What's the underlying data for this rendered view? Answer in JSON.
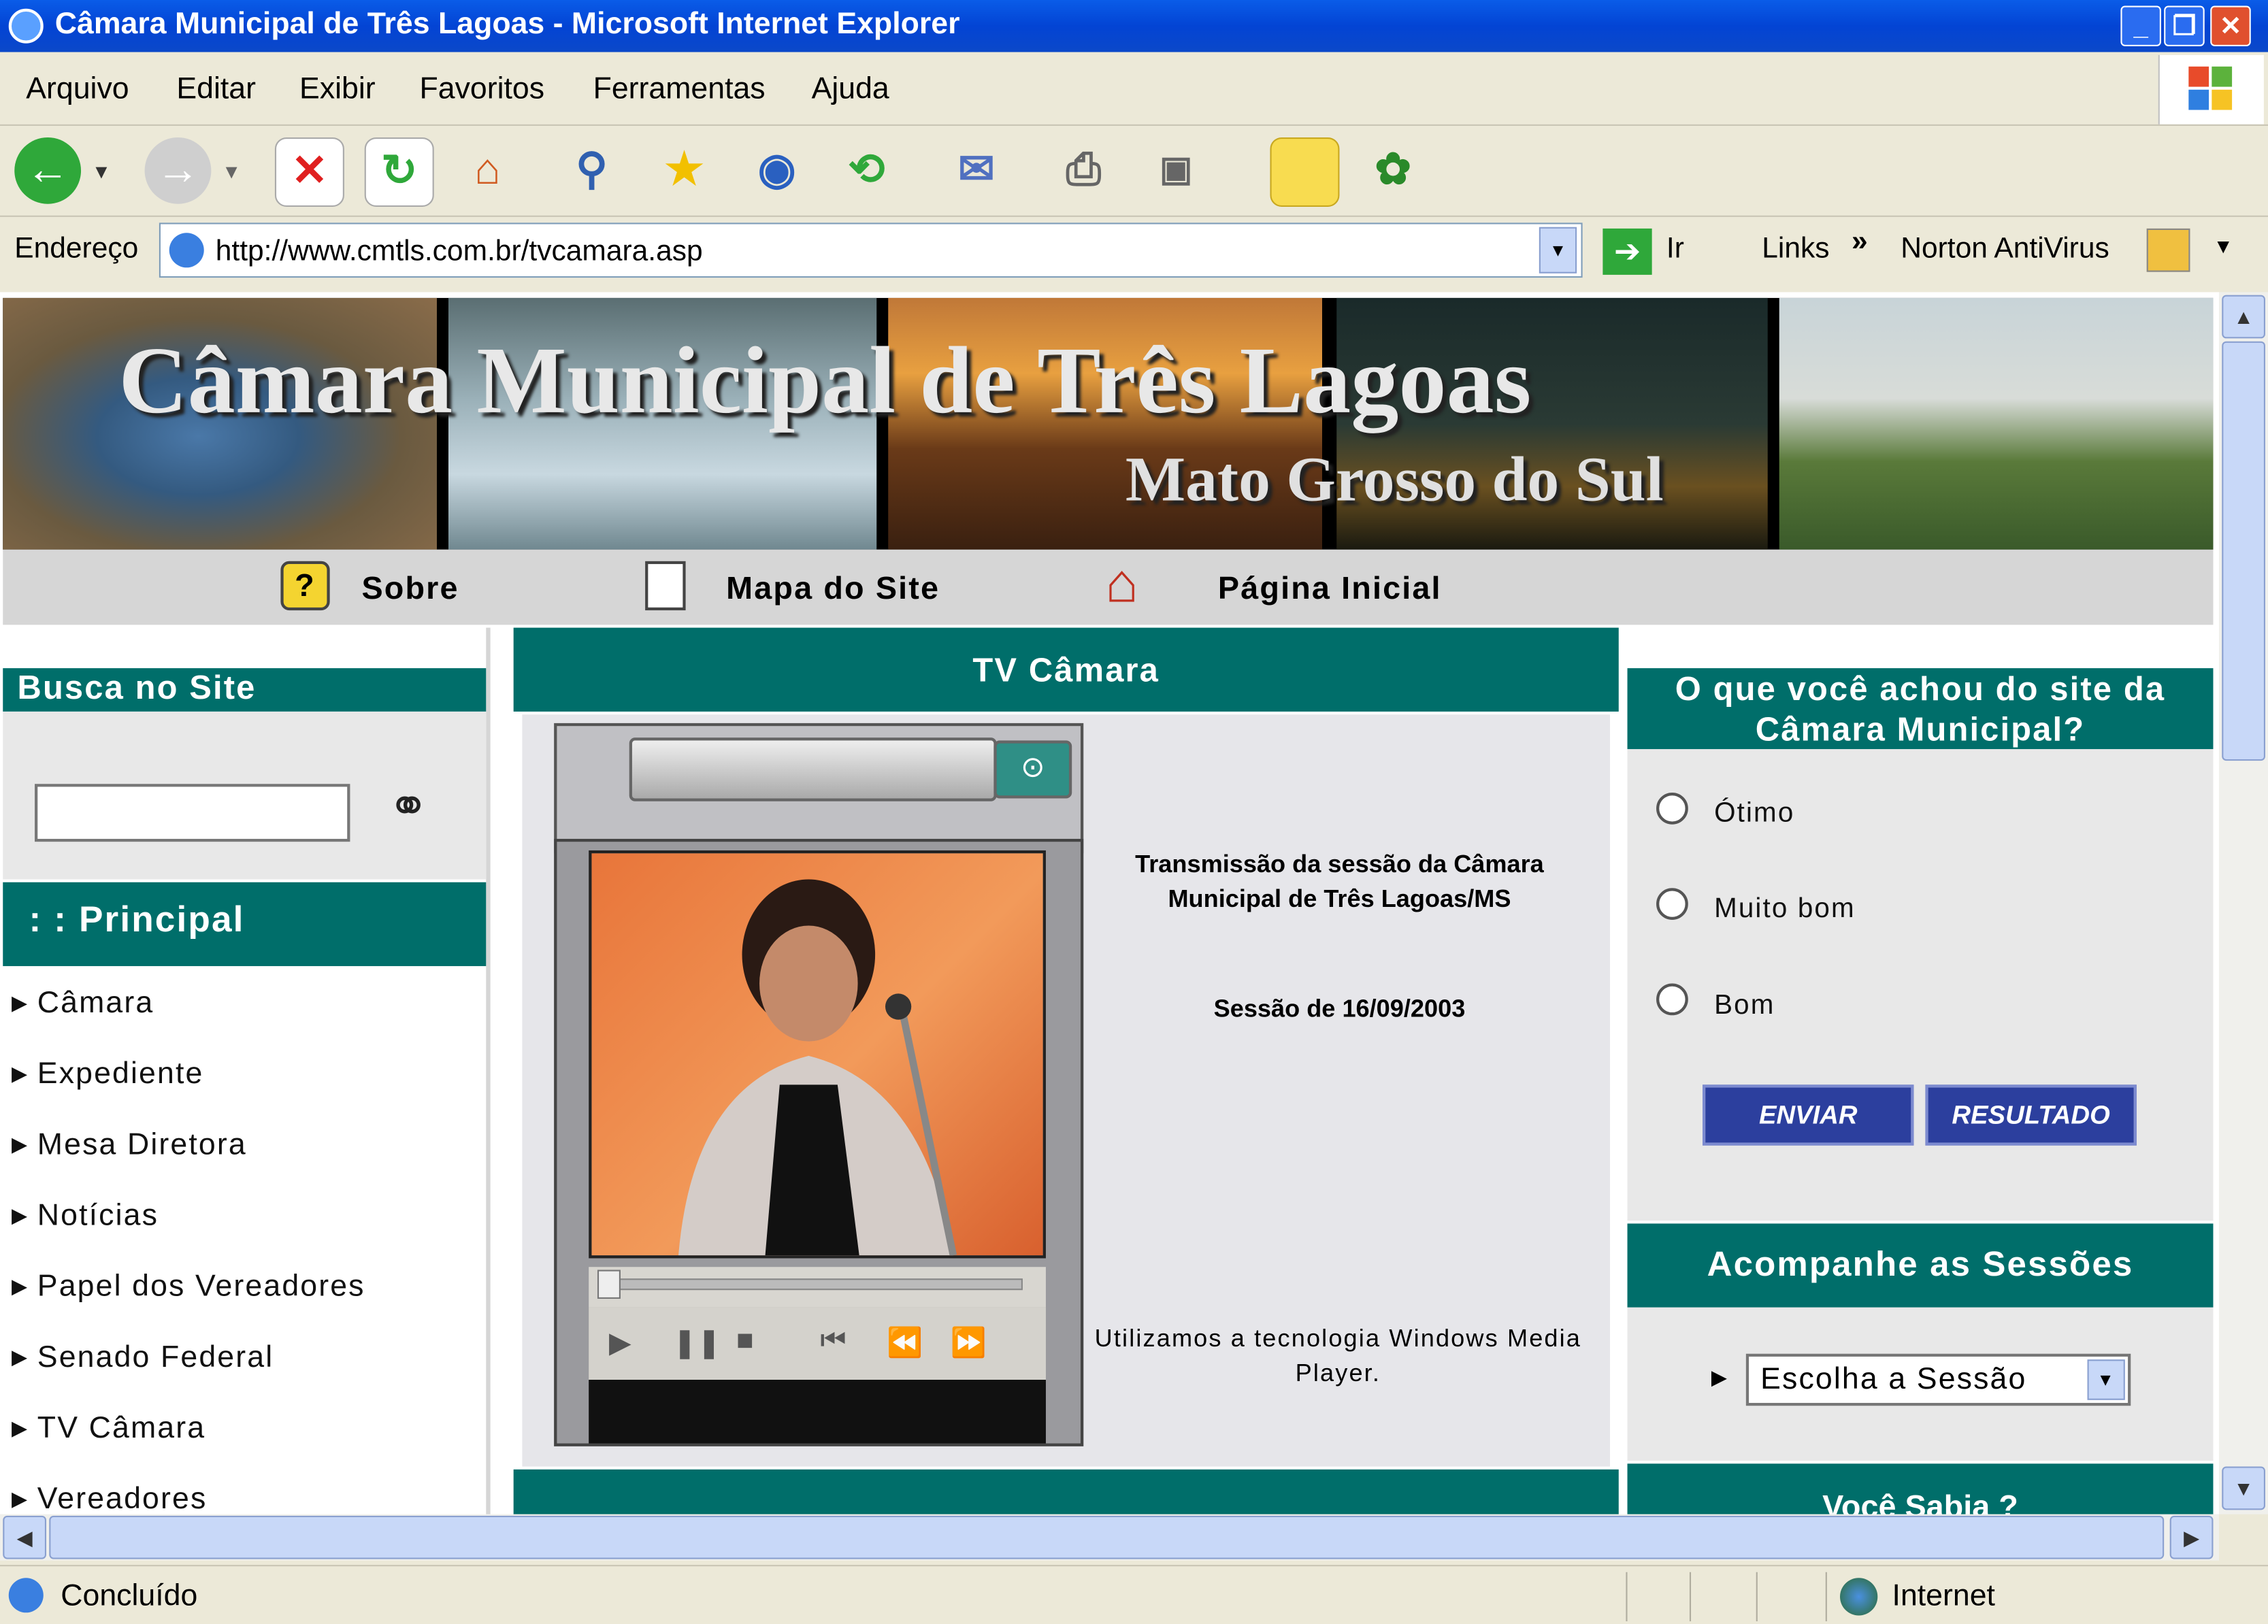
{
  "window": {
    "title": "Câmara Municipal de Três Lagoas - Microsoft Internet Explorer"
  },
  "menu": [
    "Arquivo",
    "Editar",
    "Exibir",
    "Favoritos",
    "Ferramentas",
    "Ajuda"
  ],
  "address": {
    "label": "Endereço",
    "url": "http://www.cmtls.com.br/tvcamara.asp",
    "go": "Ir",
    "links": "Links",
    "norton": "Norton AntiVirus"
  },
  "banner": {
    "title": "Câmara Municipal de Três Lagoas",
    "subtitle": "Mato Grosso do Sul"
  },
  "nav": {
    "sobre": "Sobre",
    "mapa": "Mapa do Site",
    "inicial": "Página Inicial"
  },
  "left": {
    "search_title": "Busca no Site",
    "principal": ": : Principal",
    "items": [
      "Câmara",
      "Expediente",
      "Mesa Diretora",
      "Notícias",
      "Papel dos Vereadores",
      "Senado Federal",
      "TV Câmara",
      "Vereadores"
    ]
  },
  "center": {
    "title": "TV Câmara",
    "transmission": "Transmissão da sessão da Câmara Municipal de Três Lagoas/MS",
    "session": "Sessão de 16/09/2003",
    "tech": "Utilizamos a tecnologia Windows Media Player."
  },
  "right": {
    "poll_title": "O que você achou do site da Câmara Municipal?",
    "options": [
      "Ótimo",
      "Muito bom",
      "Bom"
    ],
    "enviar": "ENVIAR",
    "resultado": "RESULTADO",
    "sessions_title": "Acompanhe as Sessões",
    "select_value": "Escolha a Sessão",
    "voce_sabia": "Você Sabia ?"
  },
  "status": {
    "text": "Concluído",
    "zone": "Internet"
  },
  "colors": {
    "teal": "#006e6a",
    "button": "#2c3f9e"
  }
}
